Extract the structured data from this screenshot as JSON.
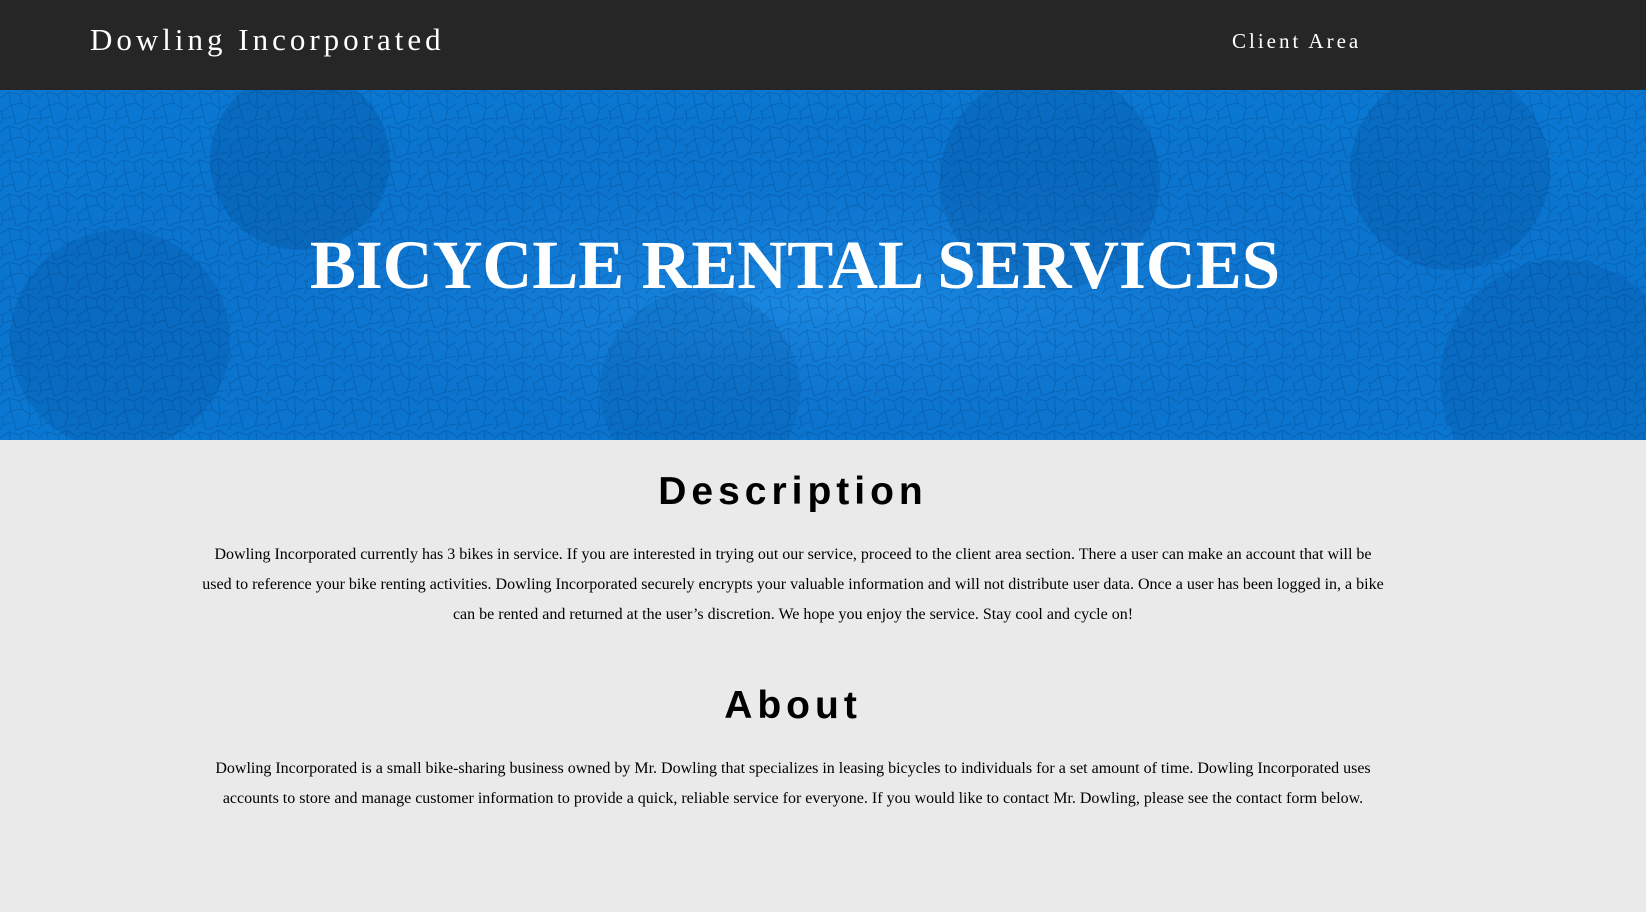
{
  "header": {
    "brand": "Dowling Incorporated",
    "nav_client_area": "Client Area"
  },
  "hero": {
    "title": "BICYCLE RENTAL SERVICES"
  },
  "description": {
    "heading": "Description",
    "text": "Dowling Incorporated currently has 3 bikes in service. If you are interested in trying out our service, proceed to the client area section. There a user can make an account that will be used to reference your bike renting activities. Dowling Incorporated securely encrypts your valuable information and will not distribute user data. Once a user has been logged in, a bike can be rented and returned at the user’s discretion. We hope you enjoy the service. Stay cool and cycle on!"
  },
  "about": {
    "heading": "About",
    "text": "Dowling Incorporated is a small bike-sharing business owned by Mr. Dowling that specializes in leasing bicycles to individuals for a set amount of time. Dowling Incorporated uses accounts to store and manage customer information to provide a quick, reliable service for everyone. If you would like to contact Mr. Dowling, please see the contact form below."
  },
  "colors": {
    "header_bg": "#262626",
    "hero_bg": "#0a78d2",
    "page_bg": "#eaeaea"
  }
}
